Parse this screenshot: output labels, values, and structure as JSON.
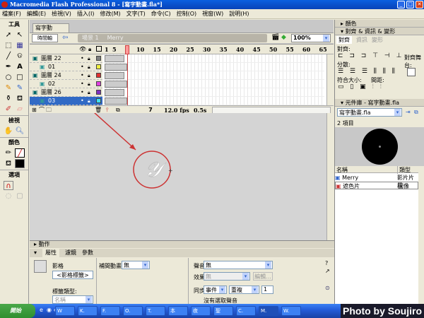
{
  "window": {
    "title": "Macromedia Flash Professional 8 - [寫字動畫.fla*]",
    "min": "_",
    "max": "□",
    "close": "✕"
  },
  "menu": [
    "檔案(F)",
    "編輯(E)",
    "檢視(V)",
    "插入(I)",
    "修改(M)",
    "文字(T)",
    "命令(C)",
    "控制(O)",
    "視窗(W)",
    "說明(H)"
  ],
  "tools": {
    "title": "工具",
    "view": "檢視",
    "colors": "顏色",
    "options": "選項"
  },
  "document": {
    "tab": "寫字動畫.fla*",
    "timeline_button": "時間軸",
    "scene": "場景 1",
    "symbol": "Merry",
    "zoom": "100%"
  },
  "timeline": {
    "frame_numbers": [
      "1",
      "5",
      "10",
      "15",
      "20",
      "25",
      "30",
      "35",
      "40",
      "45",
      "50",
      "55",
      "60",
      "65"
    ],
    "playhead_frame": 7,
    "layers": [
      {
        "name": "圖層 22",
        "type": "folder",
        "color": "#808080"
      },
      {
        "name": "01",
        "type": "mask",
        "color": "#f0f040"
      },
      {
        "name": "圖層 24",
        "type": "folder",
        "color": "#e03030"
      },
      {
        "name": "02",
        "type": "mask",
        "color": "#e040e0"
      },
      {
        "name": "圖層 26",
        "type": "folder",
        "color": "#8030c0"
      },
      {
        "name": "03",
        "type": "mask",
        "color": "#40e0f0",
        "selected": true
      }
    ],
    "current_frame": "7",
    "fps": "12.0 fps",
    "time": "0.5s"
  },
  "right": {
    "color_panel": "顏色",
    "align_panel": "對齊 & 資訊 & 變形",
    "tabs": [
      "對齊",
      "資訊",
      "變形"
    ],
    "align_label": "對齊:",
    "distribute_label": "分散:",
    "match_size": "符合大小:",
    "spacing": "間距:",
    "to_stage": "對齊舞台:",
    "library_panel": "元件庫 - 寫字動畫.fla",
    "library_select": "寫字動畫.fla",
    "item_count": "2 項目",
    "columns": [
      "名稱",
      "類型"
    ],
    "items": [
      {
        "name": "Merry",
        "type": "影片片段"
      },
      {
        "name": "遮色片",
        "type": "圖像"
      }
    ]
  },
  "properties": {
    "actions": "動作",
    "tabs": [
      "屬性",
      "濾鏡",
      "參數"
    ],
    "frame_label": "影格",
    "frame_name": "<影格標籤>",
    "label_type_label": "標籤類型:",
    "label_type": "名稱",
    "tween_label": "補間動畫:",
    "tween": "無",
    "sound_label": "聲音:",
    "sound": "無",
    "effect_label": "效果:",
    "effect": "無",
    "edit": "編輯...",
    "sync_label": "同步:",
    "sync": "事件",
    "repeat": "重複",
    "repeat_count": "1",
    "no_sound": "沒有選取聲音"
  },
  "taskbar": {
    "start": "開始",
    "tasks": [
      "W",
      "K.",
      "F.",
      "O.",
      "T.",
      "本",
      "夜",
      "聖",
      "C.",
      "M.",
      "W."
    ]
  },
  "watermark": "Photo by Soujiro"
}
